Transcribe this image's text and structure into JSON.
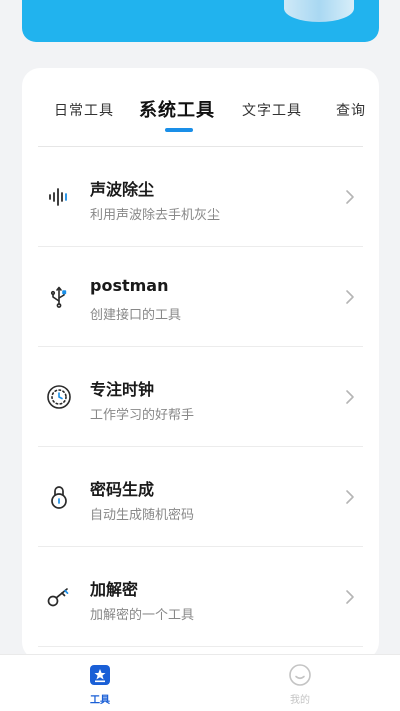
{
  "tabs": [
    {
      "label": "日常工具"
    },
    {
      "label": "系统工具"
    },
    {
      "label": "文字工具"
    },
    {
      "label": "查询"
    }
  ],
  "tools": [
    {
      "title": "声波除尘",
      "subtitle": "利用声波除去手机灰尘",
      "icon": "soundwave-icon"
    },
    {
      "title": "postman",
      "subtitle": "创建接口的工具",
      "icon": "usb-icon"
    },
    {
      "title": "专注时钟",
      "subtitle": "工作学习的好帮手",
      "icon": "clock-icon"
    },
    {
      "title": "密码生成",
      "subtitle": "自动生成随机密码",
      "icon": "lock-icon"
    },
    {
      "title": "加解密",
      "subtitle": "加解密的一个工具",
      "icon": "key-icon"
    }
  ],
  "bottom_nav": {
    "tools_label": "工具",
    "mine_label": "我的"
  },
  "colors": {
    "banner": "#21b3ee",
    "accent": "#1a8fe8",
    "nav_active": "#1a5fd6"
  }
}
